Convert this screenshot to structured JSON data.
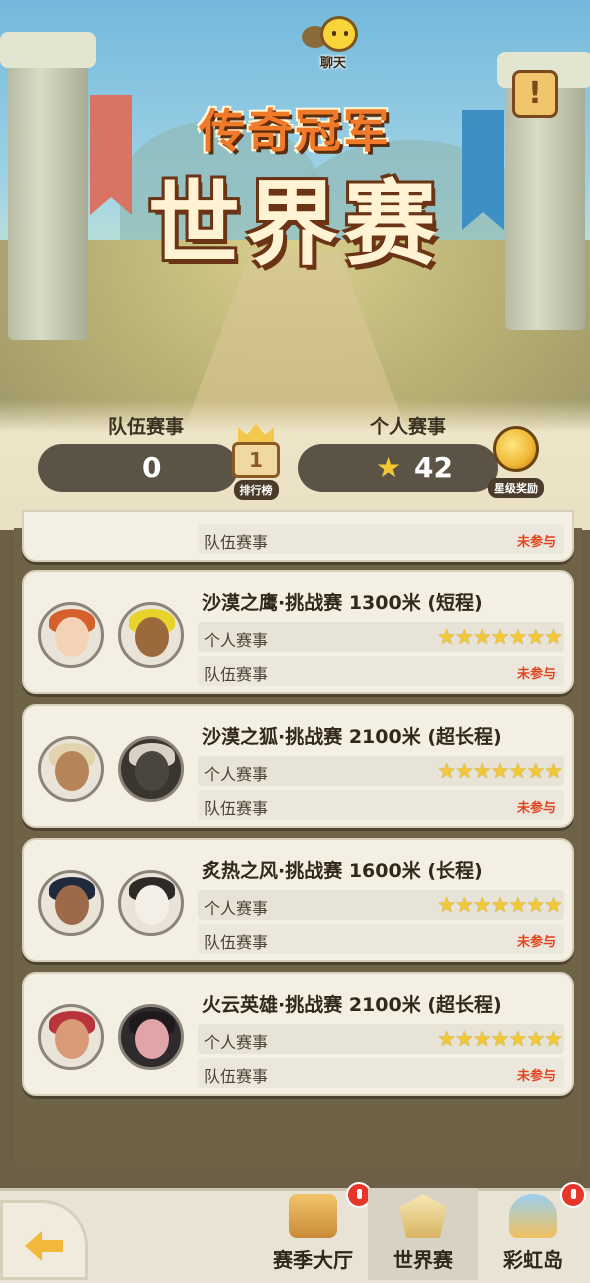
{
  "header": {
    "chat_label": "聊天",
    "title_top": "传奇冠军",
    "title_main": "世界赛"
  },
  "summary": {
    "team_label": "队伍赛事",
    "team_value": "0",
    "rank_number": "1",
    "rank_label": "排行榜",
    "personal_label": "个人赛事",
    "personal_stars": "42",
    "reward_label": "星级奖励"
  },
  "races": [
    {
      "title": "沙漠之鹰·挑战赛 1300米 (短程)",
      "personal_label": "个人赛事",
      "personal_stars": 7,
      "team_label": "队伍赛事",
      "team_status": "未参与"
    },
    {
      "title": "沙漠之狐·挑战赛 2100米 (超长程)",
      "personal_label": "个人赛事",
      "personal_stars": 7,
      "team_label": "队伍赛事",
      "team_status": "未参与"
    },
    {
      "title": "炙热之风·挑战赛 1600米 (长程)",
      "personal_label": "个人赛事",
      "personal_stars": 7,
      "team_label": "队伍赛事",
      "team_status": "未参与"
    },
    {
      "title": "火云英雄·挑战赛 2100米 (超长程)",
      "personal_label": "个人赛事",
      "personal_stars": 7,
      "team_label": "队伍赛事",
      "team_status": "未参与"
    }
  ],
  "partial_row": {
    "team_label": "队伍赛事",
    "team_status": "未参与"
  },
  "nav": {
    "season_hall": "赛季大厅",
    "world_race": "世界赛",
    "rainbow_island": "彩虹岛"
  },
  "colors": {
    "star": "#f2c935",
    "status_red": "#e2431f",
    "notification": "#e8352a"
  }
}
